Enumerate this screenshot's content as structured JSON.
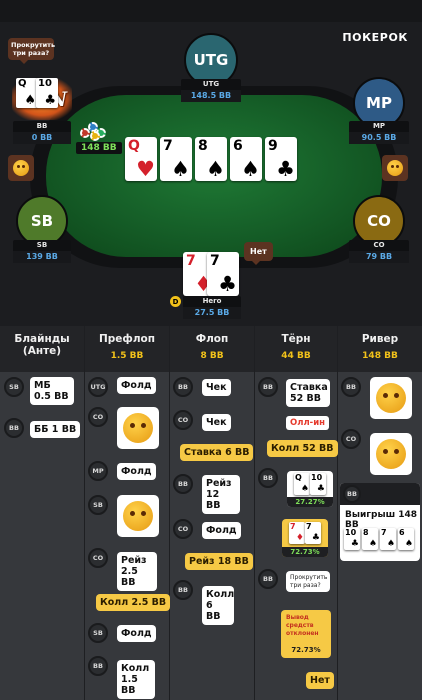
{
  "brand": "ПОКЕРОК",
  "table": {
    "pot_label": "148 BB",
    "win_badge": "WIN",
    "board": [
      {
        "rank": "Q",
        "suit": "♥",
        "red": true
      },
      {
        "rank": "7",
        "suit": "♠",
        "red": false
      },
      {
        "rank": "8",
        "suit": "♠",
        "red": false
      },
      {
        "rank": "6",
        "suit": "♠",
        "red": false
      },
      {
        "rank": "9",
        "suit": "♣",
        "red": false
      }
    ],
    "bb_bubble": "Прокрутить три раза?",
    "hero_bubble": "Нет",
    "dealer": "D"
  },
  "players": {
    "utg": {
      "avatar": "UTG",
      "name": "UTG",
      "stack": "148.5 BB",
      "color": "#2a6670"
    },
    "mp": {
      "avatar": "MP",
      "name": "MP",
      "stack": "90.5 BB",
      "color": "#2e5a86"
    },
    "sb": {
      "avatar": "SB",
      "name": "SB",
      "stack": "139 BB",
      "color": "#4f7a2a"
    },
    "co": {
      "avatar": "CO",
      "name": "CO",
      "stack": "79 BB",
      "color": "#8a6a12"
    },
    "bb": {
      "name": "BB",
      "stack": "0 BB",
      "cards": [
        {
          "rank": "Q",
          "suit": "♠"
        },
        {
          "rank": "10",
          "suit": "♣"
        }
      ]
    },
    "hero": {
      "name": "Hero",
      "stack": "27.5 BB",
      "cards": [
        {
          "rank": "7",
          "suit": "♦",
          "red": true
        },
        {
          "rank": "7",
          "suit": "♣",
          "red": false
        }
      ]
    }
  },
  "history": {
    "columns": [
      {
        "title": "Блайнды (Анте)",
        "pot": ""
      },
      {
        "title": "Префлоп",
        "pot": "1.5 BB"
      },
      {
        "title": "Флоп",
        "pot": "8 BB"
      },
      {
        "title": "Тёрн",
        "pot": "44 BB"
      },
      {
        "title": "Ривер",
        "pot": "148 BB"
      }
    ],
    "blinds": [
      {
        "pos": "SB",
        "text": "МБ 0.5 BB"
      },
      {
        "pos": "BB",
        "text": "ББ 1 BB"
      }
    ],
    "preflop": [
      {
        "pos": "UTG",
        "text": "Фолд"
      },
      {
        "pos": "CO"
      },
      {
        "pos": "MP",
        "text": "Фолд"
      },
      {
        "pos": "SB"
      },
      {
        "pos": "CO",
        "text": "Рейз 2.5 BB"
      },
      {
        "text": "Колл 2.5 BB"
      },
      {
        "pos": "SB",
        "text": "Фолд"
      },
      {
        "pos": "BB",
        "text": "Колл 1.5 BB"
      }
    ],
    "flop": [
      {
        "pos": "BB",
        "text": "Чек"
      },
      {
        "pos": "CO",
        "text": "Чек"
      },
      {
        "text": "Ставка 6 BB"
      },
      {
        "pos": "BB",
        "text": "Рейз 12 BB"
      },
      {
        "pos": "CO",
        "text": "Фолд"
      },
      {
        "text": "Рейз 18 BB"
      },
      {
        "pos": "BB",
        "text": "Колл 6 BB"
      }
    ],
    "turn": [
      {
        "pos": "BB",
        "text": "Ставка 52 BB"
      },
      {
        "text": "Олл-ин"
      },
      {
        "text": "Колл 52 BB"
      },
      {
        "pos": "BB",
        "pct": "27.27%"
      },
      {
        "pct": "72.73%"
      },
      {
        "pos": "BB",
        "text": "Прокрутить три раза?"
      },
      {
        "text": "Вывод средств отклонен",
        "pct": "72.73%"
      },
      {
        "text": "Нет"
      }
    ],
    "river": [
      {
        "pos": "BB"
      },
      {
        "pos": "CO"
      },
      {
        "pos": "BB",
        "text": "Выигрыш 148 BB"
      }
    ],
    "river_board": [
      {
        "rank": "10",
        "suit": "♣"
      },
      {
        "rank": "8",
        "suit": "♠"
      },
      {
        "rank": "7",
        "suit": "♠"
      },
      {
        "rank": "6",
        "suit": "♠"
      }
    ]
  }
}
